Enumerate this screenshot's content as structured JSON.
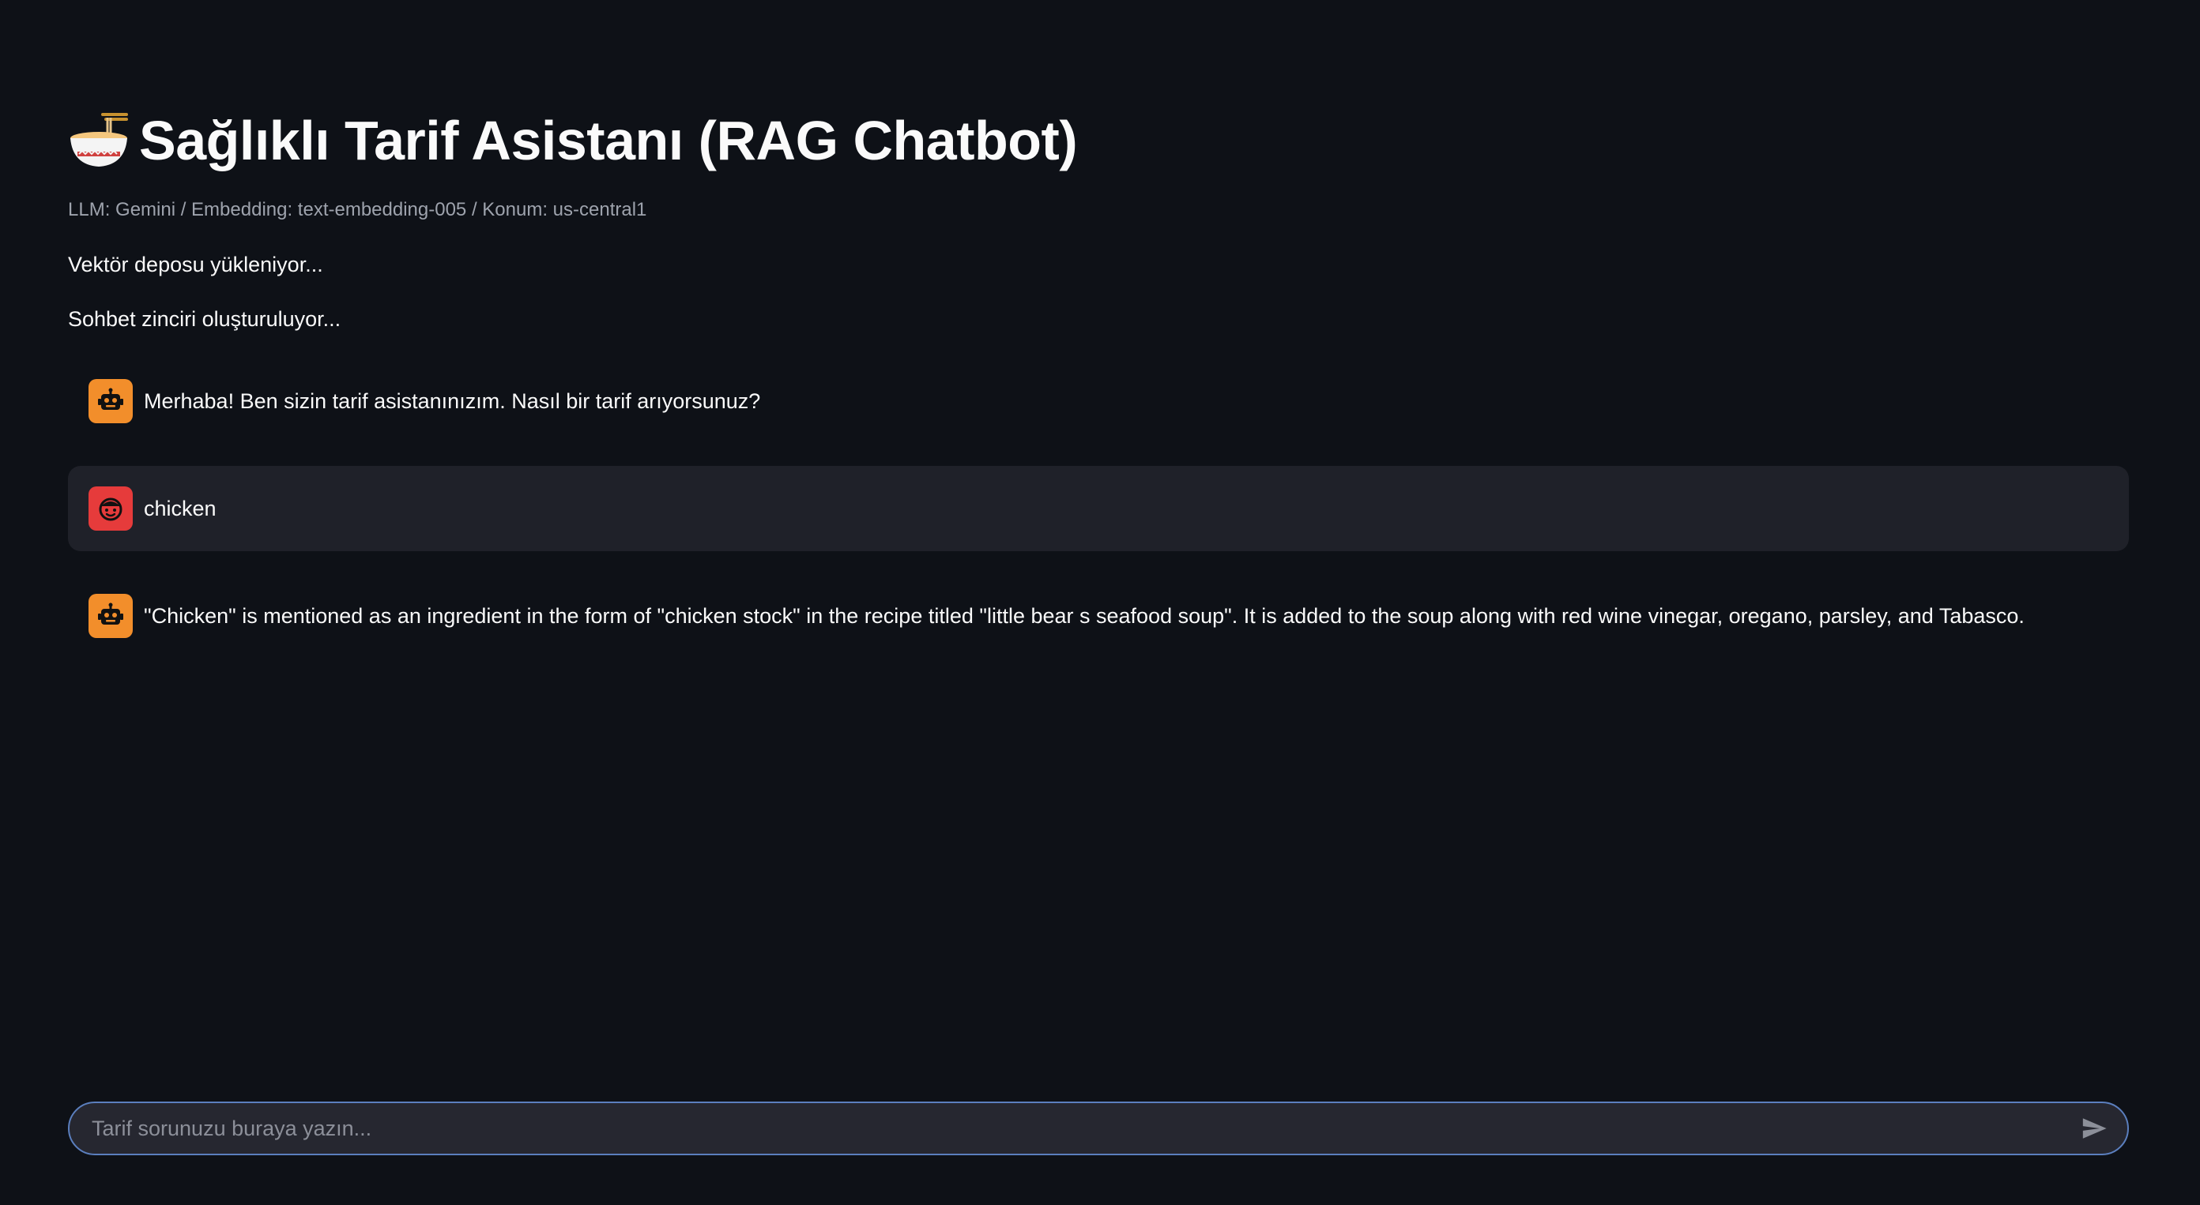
{
  "header": {
    "icon": "ramen-bowl-icon",
    "title": "Sağlıklı Tarif Asistanı (RAG Chatbot)",
    "caption": "LLM: Gemini / Embedding: text-embedding-005 / Konum: us-central1"
  },
  "status": [
    "Vektör deposu yükleniyor...",
    "Sohbet zinciri oluşturuluyor..."
  ],
  "messages": [
    {
      "role": "assistant",
      "avatar": "robot-icon",
      "text": "Merhaba! Ben sizin tarif asistanınızım. Nasıl bir tarif arıyorsunuz?"
    },
    {
      "role": "user",
      "avatar": "user-face-icon",
      "text": "chicken"
    },
    {
      "role": "assistant",
      "avatar": "robot-icon",
      "text": "\"Chicken\" is mentioned as an ingredient in the form of \"chicken stock\" in the recipe titled \"little bear s seafood soup\". It is added to the soup along with red wine vinegar, oregano, parsley, and Tabasco."
    }
  ],
  "chat_input": {
    "placeholder": "Tarif sorunuzu buraya yazın...",
    "value": "",
    "send_icon": "send-icon"
  },
  "colors": {
    "background": "#0e1117",
    "assistant_avatar": "#f28e2b",
    "user_avatar": "#e63b3b",
    "user_message_bg": "#1f2129",
    "input_border": "#5b7fbe"
  }
}
